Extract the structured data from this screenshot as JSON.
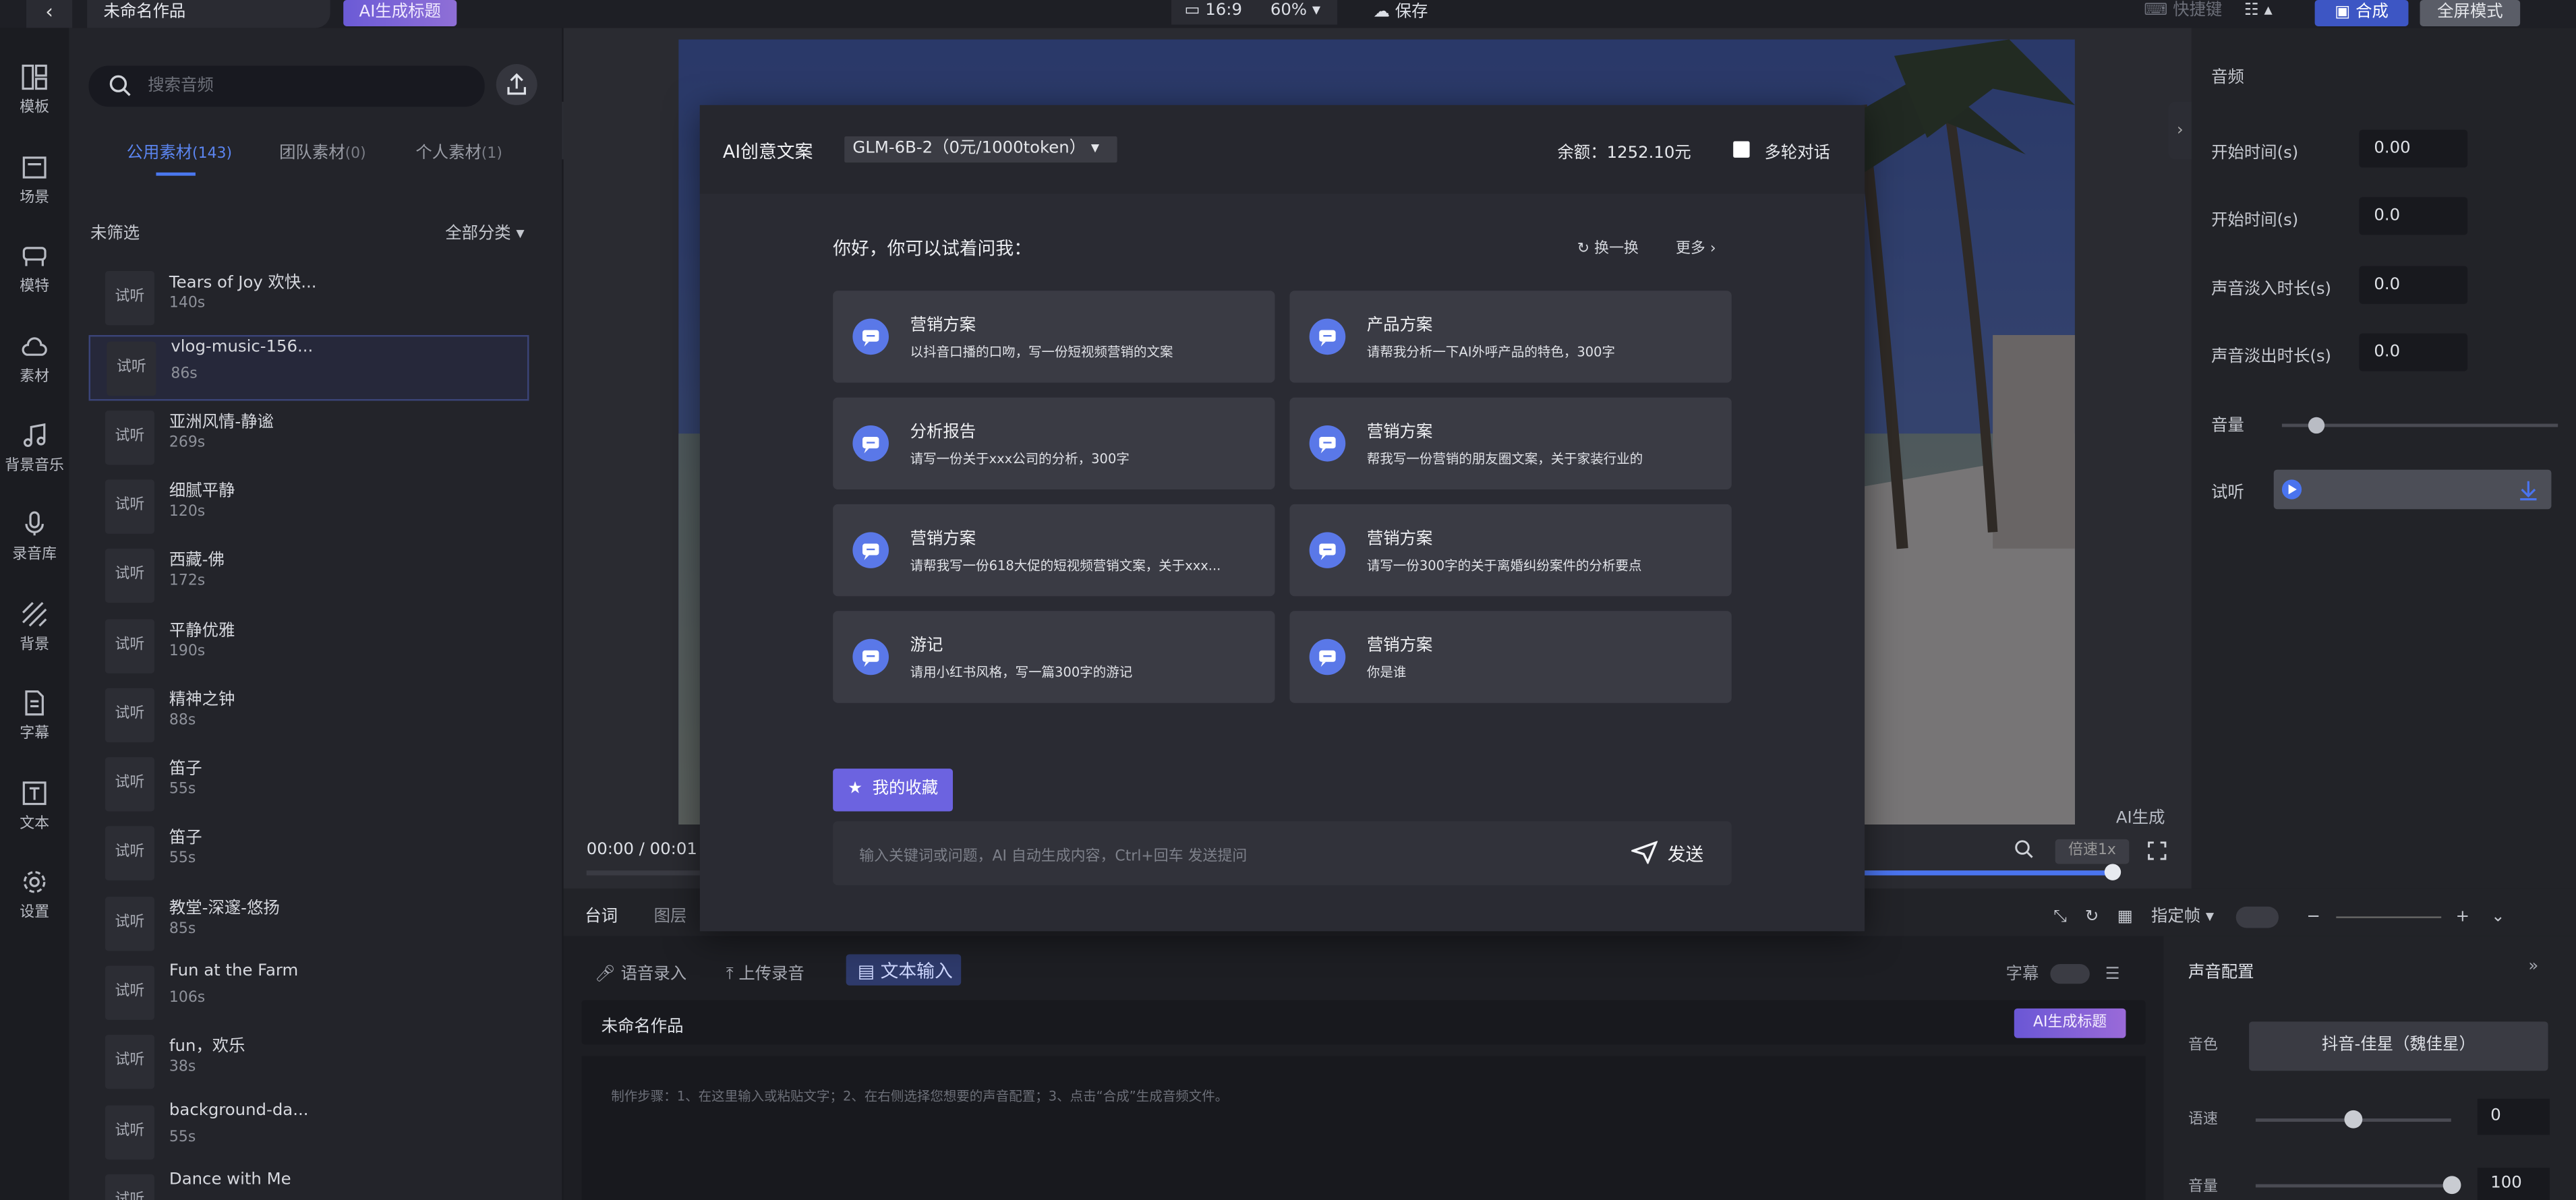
{
  "header": {
    "back_icon": "chevron-left-icon",
    "project_title": "未命名作品",
    "ai_title_label": "AI生成标题",
    "ratio": "16:9",
    "zoom": "60%",
    "save_label": "保存",
    "shortcut_label": "快捷键",
    "compose_label": "合成",
    "fullscreen_label": "全屏模式"
  },
  "nav": {
    "items": [
      {
        "label": "模板",
        "icon": "template-icon"
      },
      {
        "label": "场景",
        "icon": "scene-icon"
      },
      {
        "label": "模特",
        "icon": "model-icon"
      },
      {
        "label": "素材",
        "icon": "cloud-icon"
      },
      {
        "label": "背景音乐",
        "icon": "music-note-icon"
      },
      {
        "label": "录音库",
        "icon": "microphone-icon"
      },
      {
        "label": "背景",
        "icon": "stripes-icon"
      },
      {
        "label": "字幕",
        "icon": "document-icon"
      },
      {
        "label": "文本",
        "icon": "text-icon"
      },
      {
        "label": "设置",
        "icon": "gear-icon"
      }
    ]
  },
  "audio_panel": {
    "search_placeholder": "搜索音频",
    "tabs": [
      {
        "label": "公用素材",
        "count": "(143)"
      },
      {
        "label": "团队素材",
        "count": "(0)"
      },
      {
        "label": "个人素材",
        "count": "(1)"
      }
    ],
    "filter_label": "未筛选",
    "category_label": "全部分类",
    "try_label": "试听",
    "items": [
      {
        "name": "Tears of Joy 欢快...",
        "duration": "140s"
      },
      {
        "name": "vlog-music-156...",
        "duration": "86s"
      },
      {
        "name": "亚洲风情-静谧",
        "duration": "269s"
      },
      {
        "name": "细腻平静",
        "duration": "120s"
      },
      {
        "name": "西藏-佛",
        "duration": "172s"
      },
      {
        "name": "平静优雅",
        "duration": "190s"
      },
      {
        "name": "精神之钟",
        "duration": "88s"
      },
      {
        "name": "笛子",
        "duration": "55s"
      },
      {
        "name": "笛子",
        "duration": "55s"
      },
      {
        "name": "教堂-深邃-悠扬",
        "duration": "85s"
      },
      {
        "name": "Fun at the Farm",
        "duration": "106s"
      },
      {
        "name": "fun，欢乐",
        "duration": "38s"
      },
      {
        "name": "background-da...",
        "duration": "55s"
      },
      {
        "name": "Dance with Me",
        "duration": ""
      }
    ]
  },
  "player": {
    "time": "00:00 / 00:01",
    "watermark": "AI生成",
    "speed_label": "倍速1x",
    "progress": 0.998
  },
  "right_panel": {
    "title": "音频",
    "fields": [
      {
        "label": "开始时间(s)",
        "value": "0.00"
      },
      {
        "label": "开始时间(s)",
        "value": "0.0"
      },
      {
        "label": "声音淡入时长(s)",
        "value": "0.0"
      },
      {
        "label": "声音淡出时长(s)",
        "value": "0.0"
      }
    ],
    "volume_label": "音量",
    "volume_level": 0.12,
    "preview_label": "试听"
  },
  "bottom": {
    "tabs": [
      "台词",
      "图层"
    ],
    "frame_label": "指定帧",
    "source_tabs": [
      "语音录入",
      "上传录音",
      "文本输入"
    ],
    "subtitle_label": "字幕",
    "doc_title": "未命名作品",
    "ai_title_label": "AI生成标题",
    "placeholder": "制作步骤：1、在这里输入或粘贴文字；2、在右侧选择您想要的声音配置；3、点击“合成”生成音频文件。"
  },
  "voice_config": {
    "title": "声音配置",
    "tone_label": "音色",
    "tone_value": "抖音-佳星（魏佳星）",
    "speed_label": "语速",
    "speed_value": "0",
    "speed_level": 0.5,
    "volume_label": "音量",
    "volume_value": "100",
    "volume_level": 1.0
  },
  "modal": {
    "title": "AI创意文案",
    "model": "GLM-6B-2（0元/1000token）",
    "balance_label": "余额：",
    "balance_value": "1252.10元",
    "multi_turn_label": "多轮对话",
    "greeting": "你好，你可以试着问我：",
    "refresh_label": "换一换",
    "more_label": "更多",
    "cards": [
      {
        "title": "营销方案",
        "desc": "以抖音口播的口吻，写一份短视频营销的文案"
      },
      {
        "title": "产品方案",
        "desc": "请帮我分析一下AI外呼产品的特色，300字"
      },
      {
        "title": "分析报告",
        "desc": "请写一份关于xxx公司的分析，300字"
      },
      {
        "title": "营销方案",
        "desc": "帮我写一份营销的朋友圈文案，关于家装行业的"
      },
      {
        "title": "营销方案",
        "desc": "请帮我写一份618大促的短视频营销文案，关于xxx..."
      },
      {
        "title": "营销方案",
        "desc": "请写一份300字的关于离婚纠纷案件的分析要点"
      },
      {
        "title": "游记",
        "desc": "请用小红书风格，写一篇300字的游记"
      },
      {
        "title": "营销方案",
        "desc": "你是谁"
      }
    ],
    "favorites_label": "我的收藏",
    "input_placeholder": "输入关键词或问题，AI 自动生成内容，Ctrl+回车 发送提问",
    "send_label": "发送"
  }
}
